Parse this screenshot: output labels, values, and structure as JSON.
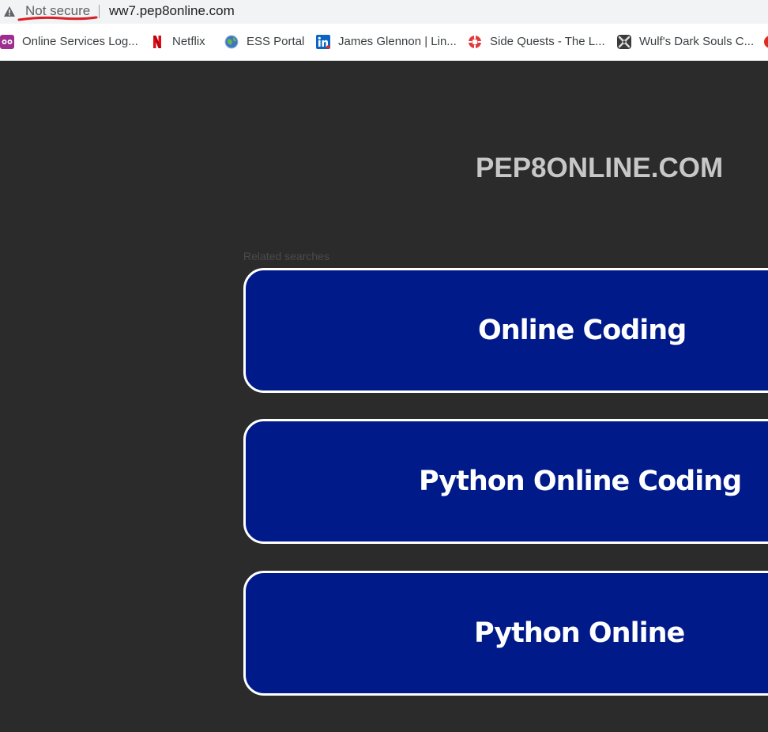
{
  "browser": {
    "security_label": "Not secure",
    "url": "ww7.pep8online.com"
  },
  "bookmarks": [
    {
      "label": "Online Services Log...",
      "icon": "owl-icon"
    },
    {
      "label": "Netflix",
      "icon": "netflix-icon"
    },
    {
      "label": "ESS Portal",
      "icon": "globe-icon"
    },
    {
      "label": "James Glennon | Lin...",
      "icon": "linkedin-icon"
    },
    {
      "label": "Side Quests - The L...",
      "icon": "lifebuoy-icon"
    },
    {
      "label": "Wulf's Dark Souls C...",
      "icon": "crossed-swords-icon"
    }
  ],
  "page": {
    "site_title": "PEP8ONLINE.COM",
    "related_label": "Related searches",
    "related_searches": [
      {
        "label": "Online Coding"
      },
      {
        "label": "Python Online Coding"
      },
      {
        "label": "Python Online"
      }
    ]
  },
  "colors": {
    "page_background": "#2b2b2b",
    "tile_background": "#001a8a",
    "tile_border": "#ffffff",
    "warning_underline": "#d91f26"
  }
}
